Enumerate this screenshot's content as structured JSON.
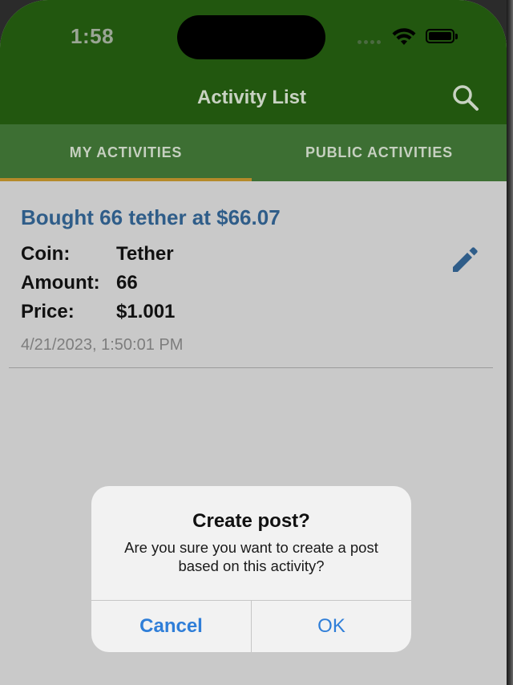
{
  "status_bar": {
    "time": "1:58"
  },
  "nav": {
    "title": "Activity List",
    "search_icon": "search-icon"
  },
  "tabs": [
    {
      "label": "MY ACTIVITIES",
      "active": true
    },
    {
      "label": "PUBLIC ACTIVITIES",
      "active": false
    }
  ],
  "activity": {
    "title": "Bought 66 tether at $66.07",
    "fields": [
      {
        "label": "Coin:",
        "value": "Tether"
      },
      {
        "label": "Amount:",
        "value": "66"
      },
      {
        "label": "Price:",
        "value": "$1.001"
      }
    ],
    "timestamp": "4/21/2023, 1:50:01 PM",
    "edit_icon": "pencil-icon"
  },
  "dialog": {
    "title": "Create post?",
    "message": "Are you sure you want to create a post based on this activity?",
    "cancel_label": "Cancel",
    "ok_label": "OK"
  },
  "colors": {
    "header": "#22570f",
    "tab_bar": "#3d6f33",
    "tab_indicator": "#b58a2a",
    "activity_title": "#2f5d89",
    "dialog_button": "#2f7ed8",
    "backdrop": "#c9c9c9"
  }
}
